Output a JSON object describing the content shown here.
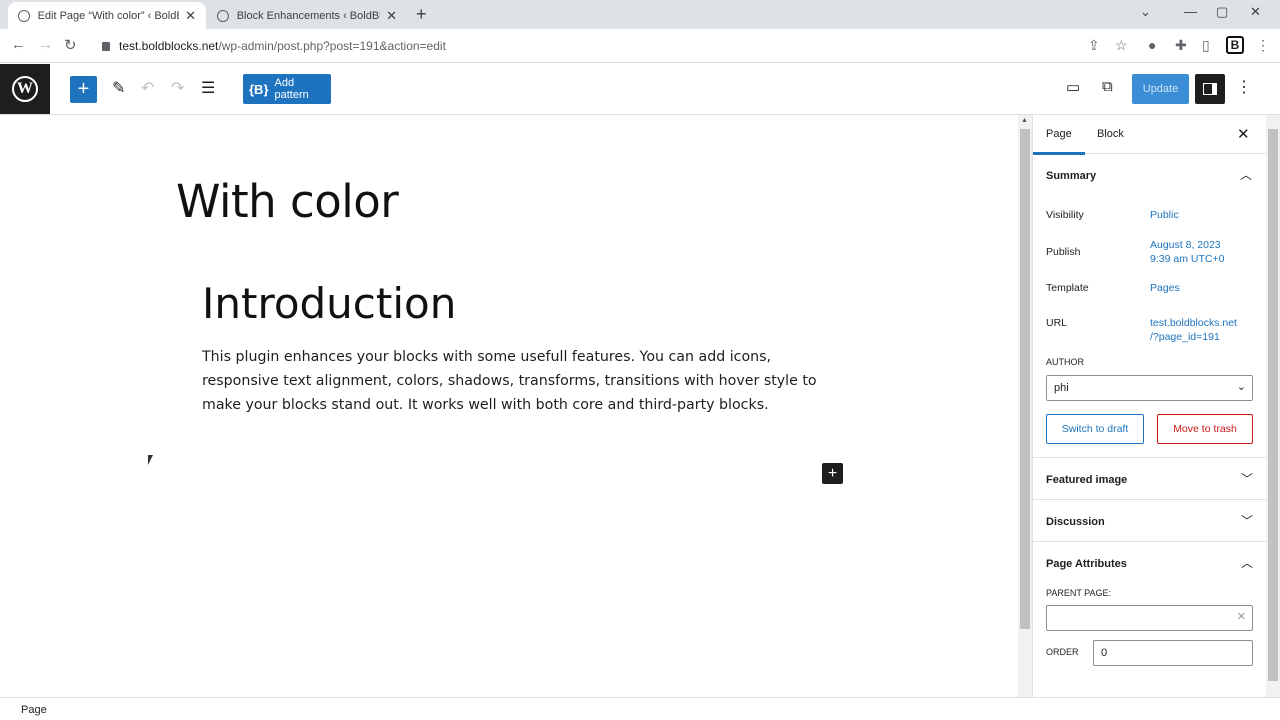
{
  "browser": {
    "tabs": [
      {
        "title": "Edit Page “With color” ‹ BoldBloc",
        "active": true
      },
      {
        "title": "Block Enhancements ‹ BoldBlocks",
        "active": false
      }
    ],
    "url_host": "test.boldblocks.net",
    "url_path": "/wp-admin/post.php?post=191&action=edit"
  },
  "toolbar": {
    "add_pattern_label": "Add pattern",
    "update_label": "Update"
  },
  "editor": {
    "title": "With color",
    "heading": "Introduction",
    "paragraph": "This plugin enhances your blocks with some usefull features. You can add icons, responsive text alignment, colors, shadows, transforms, transitions with hover style to make your blocks stand out. It works well with both core and third-party blocks."
  },
  "sidebar": {
    "tabs": [
      "Page",
      "Block"
    ],
    "summary": {
      "title": "Summary",
      "visibility_label": "Visibility",
      "visibility_value": "Public",
      "publish_label": "Publish",
      "publish_date": "August 8, 2023",
      "publish_time": "9:39 am UTC+0",
      "template_label": "Template",
      "template_value": "Pages",
      "url_label": "URL",
      "url_line1": "test.boldblocks.net",
      "url_line2": "/?page_id=191",
      "author_label": "AUTHOR",
      "author_value": "phi",
      "switch_draft": "Switch to draft",
      "move_trash": "Move to trash"
    },
    "featured_image": "Featured image",
    "discussion": "Discussion",
    "page_attributes": {
      "title": "Page Attributes",
      "parent_label": "PARENT PAGE:",
      "order_label": "ORDER",
      "order_value": "0"
    }
  },
  "footer": {
    "breadcrumb": "Page"
  },
  "colors": {
    "accent": "#1e73be",
    "danger": "#cc1818"
  }
}
